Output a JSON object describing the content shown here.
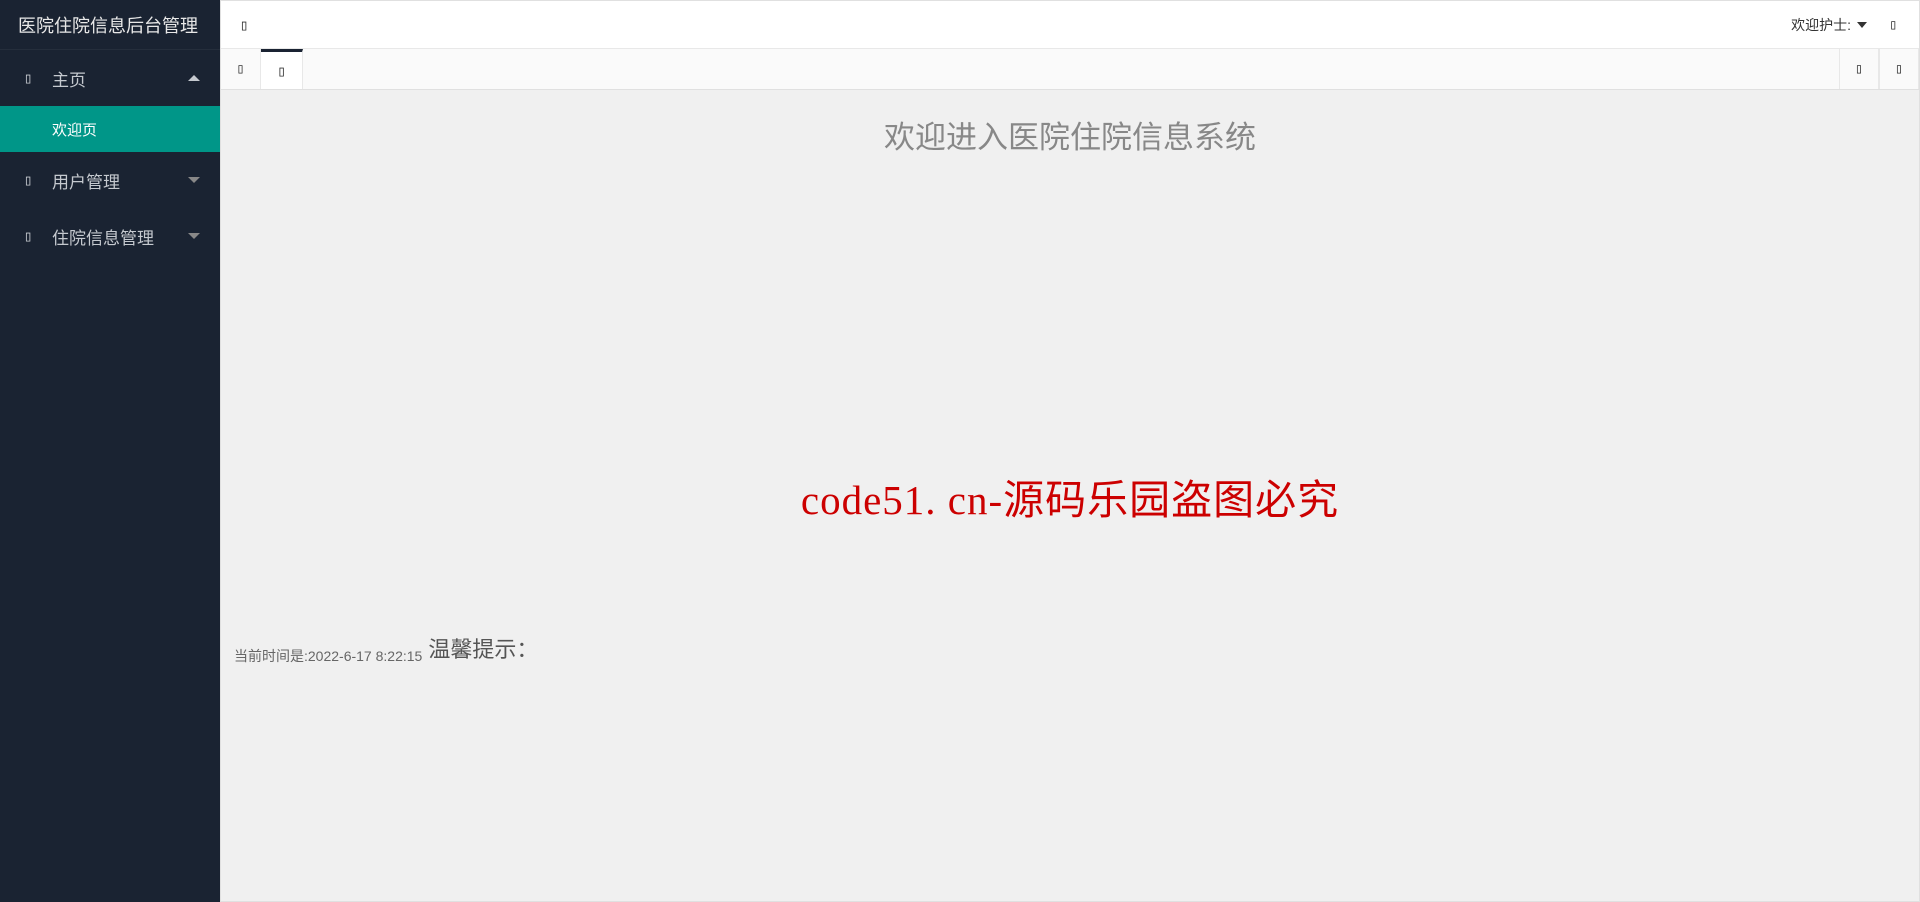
{
  "sidebar": {
    "title": "医院住院信息后台管理",
    "menu": {
      "home": {
        "label": "主页",
        "expanded": true
      },
      "home_sub": {
        "welcome": "欢迎页"
      },
      "user_mgmt": {
        "label": "用户管理",
        "expanded": false
      },
      "inpatient_mgmt": {
        "label": "住院信息管理",
        "expanded": false
      }
    }
  },
  "topbar": {
    "user_label": "欢迎护士:"
  },
  "content": {
    "welcome_title": "欢迎进入医院住院信息系统",
    "watermark": "code51. cn-源码乐园盗图必究",
    "time_prefix": "当前时间是:",
    "time_value": "2022-6-17 8:22:15",
    "warm_tip": "温馨提示："
  },
  "placeholder": "▯"
}
